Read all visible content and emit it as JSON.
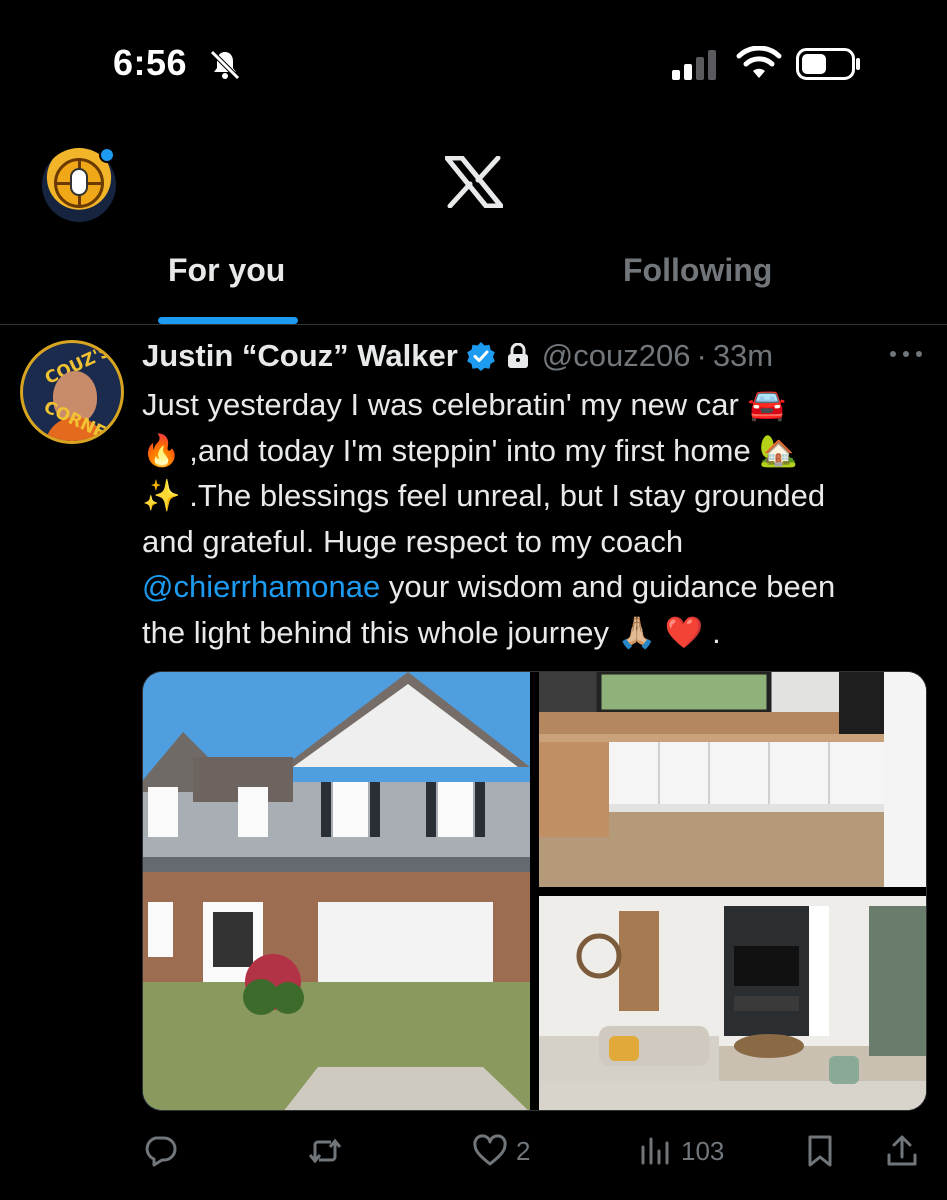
{
  "status_bar": {
    "time": "6:56",
    "icons": [
      "bell-slash-icon",
      "signal-icon",
      "wifi-icon",
      "battery-icon"
    ]
  },
  "header": {
    "logo": "x-logo-icon",
    "tabs": [
      {
        "label": "For you",
        "active": true
      },
      {
        "label": "Following",
        "active": false
      }
    ]
  },
  "tweet": {
    "author_name": "Justin “Couz” Walker",
    "handle": "@couz206",
    "separator": "·",
    "time": "33m",
    "avatar_text_top": "COUZ'S",
    "avatar_text_bottom": "CORNER",
    "text_lines": [
      "Just yesterday I was celebratin' my new car 🚘",
      "🔥 ,and today I'm steppin' into my first home 🏡",
      "✨ .The blessings feel unreal, but I stay grounded",
      "and grateful. Huge respect to my coach",
      " your wisdom and guidance been",
      "the light behind this whole journey 🙏🏼 ❤️ ."
    ],
    "mention": "@chierrhamonae",
    "media": [
      {
        "alt": "house-exterior"
      },
      {
        "alt": "kitchen"
      },
      {
        "alt": "living-room"
      }
    ],
    "actions": {
      "reply_count": "",
      "retweet_count": "",
      "like_count": "2",
      "views_count": "103"
    }
  },
  "colors": {
    "accent": "#1d9bf0",
    "muted": "#71767b",
    "text": "#e7e9ea",
    "background": "#000000"
  }
}
